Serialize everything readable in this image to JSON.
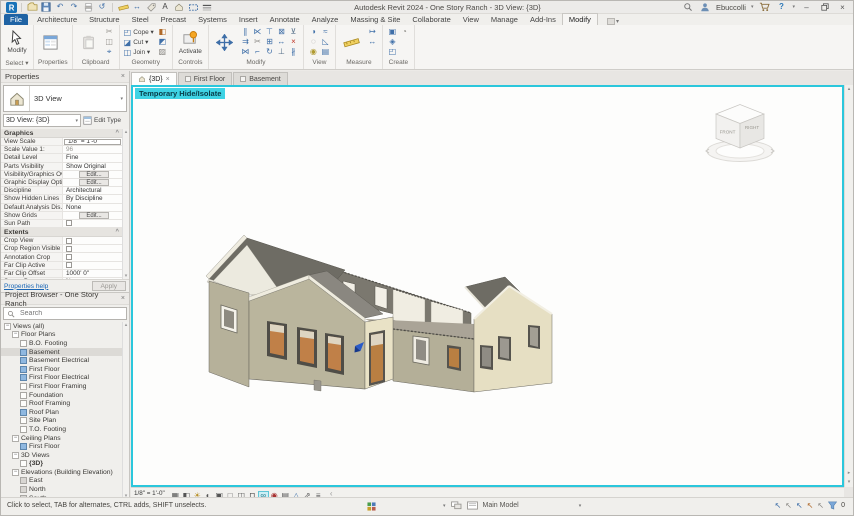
{
  "titlebar": {
    "title": "Autodesk Revit 2024 - One Story Ranch - 3D View: {3D}",
    "user": "Ebuccolli",
    "qat": [
      "revit-logo",
      "open-file",
      "save",
      "undo",
      "redo",
      "print",
      "sync-with-central",
      "measure",
      "aligned-dimension",
      "tag",
      "text",
      "default-3d-view",
      "section",
      "thin-lines"
    ]
  },
  "ribbon": {
    "tabs": [
      {
        "label": "File",
        "style": "file"
      },
      {
        "label": "Architecture"
      },
      {
        "label": "Structure"
      },
      {
        "label": "Steel"
      },
      {
        "label": "Precast"
      },
      {
        "label": "Systems"
      },
      {
        "label": "Insert"
      },
      {
        "label": "Annotate"
      },
      {
        "label": "Analyze"
      },
      {
        "label": "Massing & Site"
      },
      {
        "label": "Collaborate"
      },
      {
        "label": "View"
      },
      {
        "label": "Manage"
      },
      {
        "label": "Add-Ins"
      },
      {
        "label": "Modify",
        "active": true
      }
    ],
    "panels": [
      {
        "label": "Select ▾",
        "big": [
          {
            "icon": "modify-cursor",
            "label": "Modify"
          }
        ]
      },
      {
        "label": "Properties",
        "big": [
          {
            "icon": "properties-palette",
            "label": ""
          }
        ]
      },
      {
        "label": "Clipboard",
        "big": [
          {
            "icon": "paste",
            "label": ""
          }
        ],
        "grid": [
          "cut-to-clipboard",
          "copy-to-clipboard",
          "match-type"
        ]
      },
      {
        "label": "Geometry",
        "rows": [
          {
            "icon": "cope",
            "label": "Cope ▾"
          },
          {
            "icon": "cut-geometry",
            "label": "Cut ▾"
          },
          {
            "icon": "join-geometry",
            "label": "Join ▾"
          }
        ],
        "grid": [
          "paint",
          "split-face",
          "demolish"
        ]
      },
      {
        "label": "Controls",
        "big": [
          {
            "icon": "activate-controls",
            "label": "Activate"
          }
        ]
      },
      {
        "label": "Modify",
        "big": [
          {
            "icon": "move",
            "label": ""
          }
        ],
        "grid": [
          "align",
          "offset",
          "mirror-pick-axis",
          "mirror-draw-axis",
          "split-element",
          "trim-extend-corner",
          "trim-extend-single",
          "copy",
          "rotate",
          "array",
          "scale",
          "pin",
          "unpin",
          "delete",
          "split-with-gap"
        ]
      },
      {
        "label": "View",
        "grid": [
          "override-graphics",
          "hide-in-view",
          "display-hidden",
          "linework",
          "cut-profile",
          "view-range"
        ]
      },
      {
        "label": "Measure",
        "big": [
          {
            "icon": "measure-ruler",
            "label": ""
          }
        ],
        "grid": [
          "measure-between",
          "dimension-aligned"
        ]
      },
      {
        "label": "Create",
        "grid": [
          "create-group",
          "create-similar",
          "create-assembly",
          "create-parts"
        ]
      }
    ]
  },
  "properties": {
    "header": "Properties",
    "type_selector": {
      "label": "3D View"
    },
    "instance_selector": {
      "label": "3D View: {3D}"
    },
    "edit_type_label": "Edit Type",
    "sections": [
      {
        "header": "Graphics",
        "rows": [
          {
            "label": "View Scale",
            "value": "1/8\" = 1'-0\"",
            "kind": "input"
          },
          {
            "label": "Scale Value    1:",
            "value": "96",
            "kind": "disabled"
          },
          {
            "label": "Detail Level",
            "value": "Fine",
            "kind": "text"
          },
          {
            "label": "Parts Visibility",
            "value": "Show Original",
            "kind": "text"
          },
          {
            "label": "Visibility/Graphics Ov...",
            "value": "Edit...",
            "kind": "button"
          },
          {
            "label": "Graphic Display Opti...",
            "value": "Edit...",
            "kind": "button"
          },
          {
            "label": "Discipline",
            "value": "Architectural",
            "kind": "text"
          },
          {
            "label": "Show Hidden Lines",
            "value": "By Discipline",
            "kind": "text"
          },
          {
            "label": "Default Analysis Dis...",
            "value": "None",
            "kind": "text"
          },
          {
            "label": "Show Grids",
            "value": "Edit...",
            "kind": "button"
          },
          {
            "label": "Sun Path",
            "value": "",
            "kind": "check"
          }
        ]
      },
      {
        "header": "Extents",
        "rows": [
          {
            "label": "Crop View",
            "value": "",
            "kind": "check"
          },
          {
            "label": "Crop Region Visible",
            "value": "",
            "kind": "check"
          },
          {
            "label": "Annotation Crop",
            "value": "",
            "kind": "check"
          },
          {
            "label": "Far Clip Active",
            "value": "",
            "kind": "check"
          },
          {
            "label": "Far Clip Offset",
            "value": "1000' 0\"",
            "kind": "text"
          },
          {
            "label": "Scope Box",
            "value": "None",
            "kind": "text"
          }
        ]
      }
    ],
    "help_link": "Properties help",
    "apply_label": "Apply"
  },
  "browser": {
    "header": "Project Browser - One Story Ranch",
    "search_placeholder": "Search",
    "tree": [
      {
        "label": "Views (all)",
        "depth": 0,
        "group": true
      },
      {
        "label": "Floor Plans",
        "depth": 1,
        "group": true
      },
      {
        "label": "B.O. Footing",
        "depth": 2,
        "icon": "plan"
      },
      {
        "label": "Basement",
        "depth": 2,
        "icon": "plan-blue",
        "selected": true
      },
      {
        "label": "Basement Electrical",
        "depth": 2,
        "icon": "plan-blue"
      },
      {
        "label": "First Floor",
        "depth": 2,
        "icon": "plan-blue"
      },
      {
        "label": "First Floor Electrical",
        "depth": 2,
        "icon": "plan-blue"
      },
      {
        "label": "First Floor Framing",
        "depth": 2,
        "icon": "plan"
      },
      {
        "label": "Foundation",
        "depth": 2,
        "icon": "plan"
      },
      {
        "label": "Roof Framing",
        "depth": 2,
        "icon": "plan"
      },
      {
        "label": "Roof Plan",
        "depth": 2,
        "icon": "plan-blue"
      },
      {
        "label": "Site Plan",
        "depth": 2,
        "icon": "plan"
      },
      {
        "label": "T.O. Footing",
        "depth": 2,
        "icon": "plan"
      },
      {
        "label": "Ceiling Plans",
        "depth": 1,
        "group": true
      },
      {
        "label": "First Floor",
        "depth": 2,
        "icon": "plan-blue"
      },
      {
        "label": "3D Views",
        "depth": 1,
        "group": true
      },
      {
        "label": "{3D}",
        "depth": 2,
        "icon": "plan",
        "bold": true
      },
      {
        "label": "Elevations (Building Elevation)",
        "depth": 1,
        "group": true
      },
      {
        "label": "East",
        "depth": 2,
        "icon": "elevation"
      },
      {
        "label": "North",
        "depth": 2,
        "icon": "elevation"
      },
      {
        "label": "South",
        "depth": 2,
        "icon": "elevation"
      }
    ]
  },
  "view_tabs": [
    {
      "label": "{3D}",
      "active": true
    },
    {
      "label": "First Floor"
    },
    {
      "label": "Basement"
    }
  ],
  "viewport": {
    "overlay": "Temporary Hide/Isolate",
    "border_color": "#2bc7dc",
    "viewcube": {
      "front": "FRONT",
      "right": "RIGHT"
    }
  },
  "view_control_bar": {
    "scale": "1/8\" = 1'-0\"",
    "icons": [
      "detail-level",
      "visual-style",
      "sun-path",
      "shadows",
      "show-rendering-dialog",
      "crop-view",
      "show-crop-region",
      "unlocked-3d-view",
      "temporary-hide-isolate",
      "reveal-hidden-elements",
      "temporary-view-properties",
      "show-analytical-model",
      "highlight-displacement-sets",
      "reveal-constraints"
    ]
  },
  "statusbar": {
    "hint": "Click to select, TAB for alternates, CTRL adds, SHIFT unselects.",
    "design_option": "Main Model",
    "filter_count": "0",
    "toggles": [
      "select-links",
      "select-underlay-elements",
      "select-pinned-elements",
      "select-elements-by-face",
      "drag-elements-on-selection"
    ]
  }
}
